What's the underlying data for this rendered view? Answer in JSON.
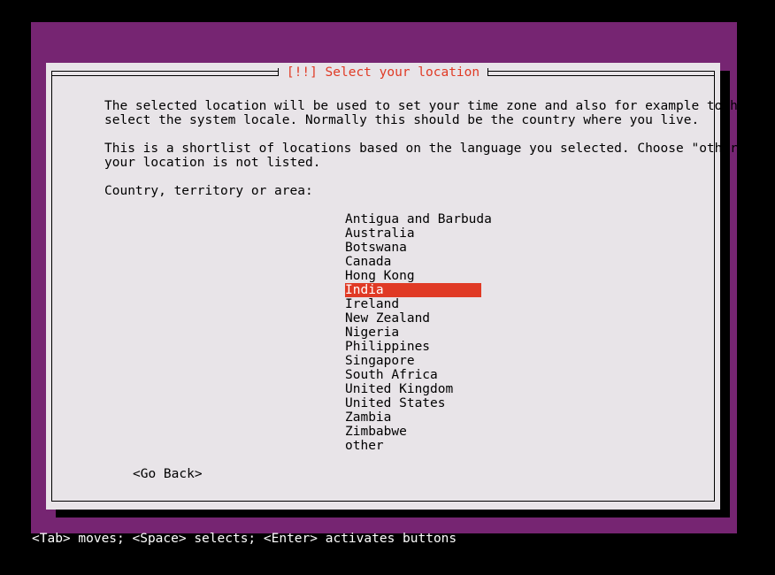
{
  "screen": {
    "background_color": "#000000",
    "backdrop_color": "#762572",
    "dialog_background": "#e8e4e8",
    "accent_color": "#e03a25",
    "text_color": "#000000",
    "footer_text_color": "#ffffff"
  },
  "dialog": {
    "title": "[!!] Select your location",
    "paragraphs": [
      "The selected location will be used to set your time zone and also for example to help\nselect the system locale. Normally this should be the country where you live.",
      "This is a shortlist of locations based on the language you selected. Choose \"other\" if\nyour location is not listed."
    ],
    "list_label": "Country, territory or area:",
    "countries": [
      {
        "label": "Antigua and Barbuda",
        "selected": false
      },
      {
        "label": "Australia",
        "selected": false
      },
      {
        "label": "Botswana",
        "selected": false
      },
      {
        "label": "Canada",
        "selected": false
      },
      {
        "label": "Hong Kong",
        "selected": false
      },
      {
        "label": "India",
        "selected": true
      },
      {
        "label": "Ireland",
        "selected": false
      },
      {
        "label": "New Zealand",
        "selected": false
      },
      {
        "label": "Nigeria",
        "selected": false
      },
      {
        "label": "Philippines",
        "selected": false
      },
      {
        "label": "Singapore",
        "selected": false
      },
      {
        "label": "South Africa",
        "selected": false
      },
      {
        "label": "United Kingdom",
        "selected": false
      },
      {
        "label": "United States",
        "selected": false
      },
      {
        "label": "Zambia",
        "selected": false
      },
      {
        "label": "Zimbabwe",
        "selected": false
      },
      {
        "label": "other",
        "selected": false
      }
    ],
    "selected_country": "India",
    "go_back_label": "<Go Back>"
  },
  "footer": {
    "help_text": "<Tab> moves; <Space> selects; <Enter> activates buttons"
  }
}
